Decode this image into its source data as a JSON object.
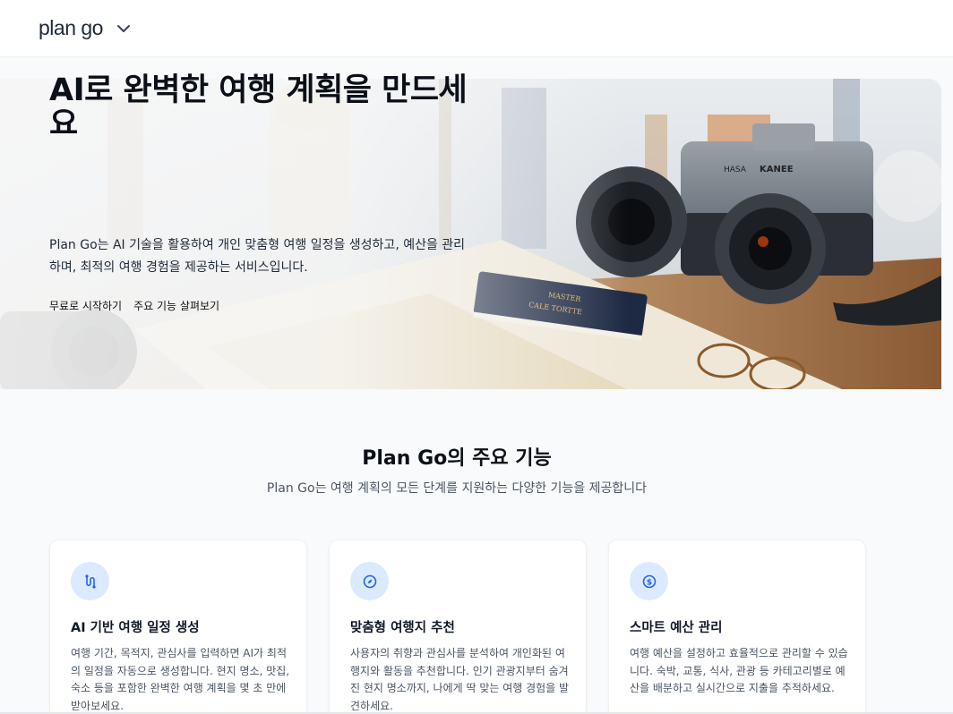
{
  "header": {
    "logo": "plan go"
  },
  "hero": {
    "title": "AI로 완벽한 여행 계획을 만드세요",
    "description": "Plan Go는 AI 기술을 활용하여 개인 맞춤형 여행 일정을 생성하고, 예산을 관리하며, 최적의 여행 경험을 제공하는 서비스입니다.",
    "cta_primary": "무료로 시작하기",
    "cta_secondary": "주요 기능 살펴보기"
  },
  "features": {
    "title": "Plan Go의 주요 기능",
    "subtitle": "Plan Go는 여행 계획의 모든 단계를 지원하는 다양한 기능을 제공합니다",
    "cards": [
      {
        "icon": "route-icon",
        "title": "AI 기반 여행 일정 생성",
        "description": "여행 기간, 목적지, 관심사를 입력하면 AI가 최적의 일정을 자동으로 생성합니다. 현지 명소, 맛집, 숙소 등을 포함한 완벽한 여행 계획을 몇 초 만에 받아보세요."
      },
      {
        "icon": "compass-icon",
        "title": "맞춤형 여행지 추천",
        "description": "사용자의 취향과 관심사를 분석하여 개인화된 여행지와 활동을 추천합니다. 인기 관광지부터 숨겨진 현지 명소까지, 나에게 딱 맞는 여행 경험을 발견하세요."
      },
      {
        "icon": "dollar-circle-icon",
        "title": "스마트 예산 관리",
        "description": "여행 예산을 설정하고 효율적으로 관리할 수 있습니다. 숙박, 교통, 식사, 관광 등 카테고리별로 예산을 배분하고 실시간으로 지출을 추적하세요."
      }
    ]
  },
  "colors": {
    "accent": "#2563eb",
    "icon_bg": "#dbeafe"
  }
}
